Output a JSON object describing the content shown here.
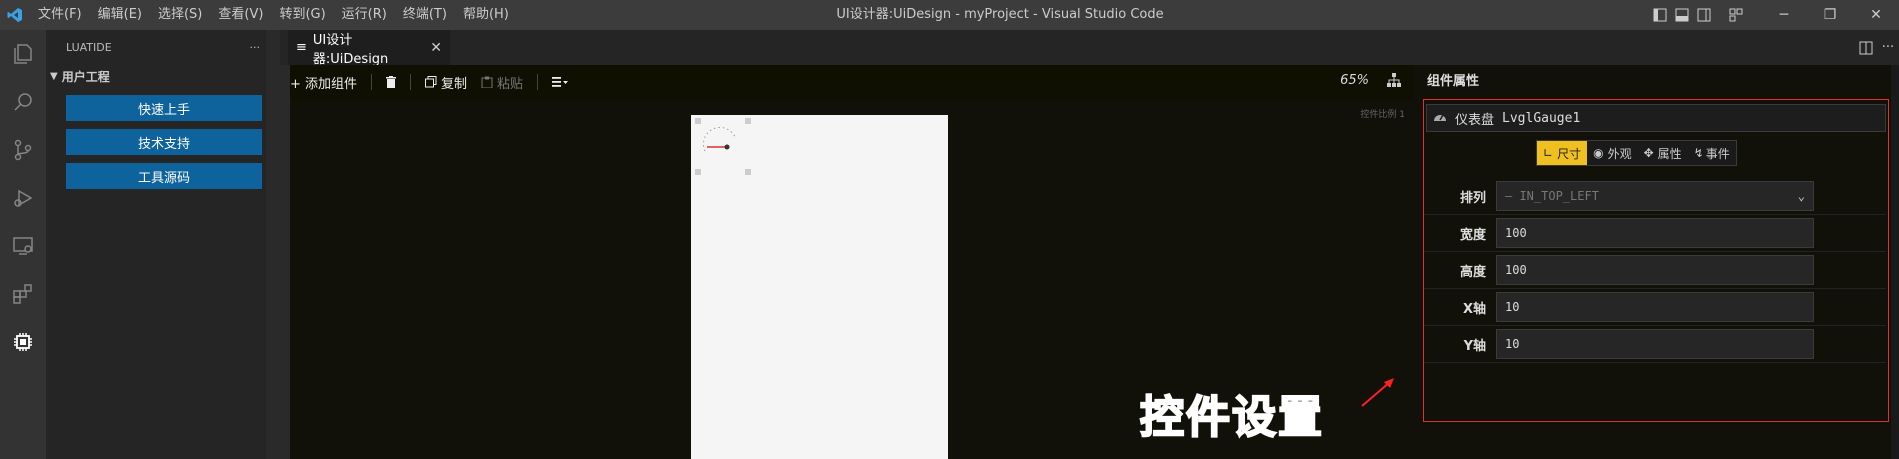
{
  "menu": [
    "文件(F)",
    "编辑(E)",
    "选择(S)",
    "查看(V)",
    "转到(G)",
    "运行(R)",
    "终端(T)",
    "帮助(H)"
  ],
  "window_title": "UI设计器:UiDesign - myProject - Visual Studio Code",
  "sidebar": {
    "header": "LUATIDE",
    "more": "···",
    "section": "用户工程",
    "buttons": [
      "快速上手",
      "技术支持",
      "工具源码"
    ]
  },
  "tab": {
    "icon": "≡",
    "label": "UI设计器:UiDesign",
    "close": "✕"
  },
  "toolbar": {
    "add": "+ 添加组件",
    "copy": "复制",
    "paste": "粘贴",
    "zoom": "65%"
  },
  "canvas": {
    "ratio_label": "控件比例 1"
  },
  "props": {
    "title": "组件属性",
    "component_type": "仪表盘",
    "component_name": "LvglGauge1",
    "tabs": [
      "尺寸",
      "外观",
      "属性",
      "事件"
    ],
    "rows": [
      {
        "label": "排列",
        "value": "— IN_TOP_LEFT",
        "type": "select"
      },
      {
        "label": "宽度",
        "value": "100",
        "type": "input"
      },
      {
        "label": "高度",
        "value": "100",
        "type": "input"
      },
      {
        "label": "X轴",
        "value": "10",
        "type": "input"
      },
      {
        "label": "Y轴",
        "value": "10",
        "type": "input"
      }
    ]
  },
  "annotation": "控件设置",
  "colors": {
    "accent": "#0e639c",
    "tab_active": "#f0c020",
    "highlight": "#e03030"
  }
}
